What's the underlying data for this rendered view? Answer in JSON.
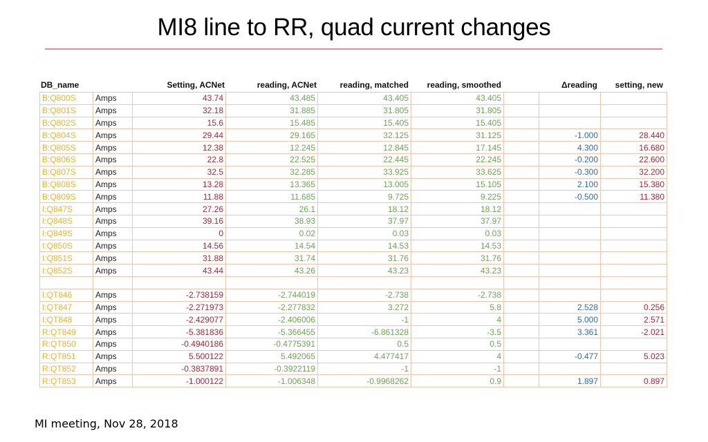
{
  "slide": {
    "title": "MI8 line to RR, quad current changes",
    "footer": "MI meeting, Nov 28, 2018"
  },
  "colors": {
    "title_rule": "#f08a8a",
    "grid_border": "#f5c4a8",
    "name": "#f0b428",
    "setting": "#b22433",
    "reading": "#6aa84f",
    "delta": "#2e6bb3",
    "setting_new": "#b22433"
  },
  "table": {
    "headers": {
      "db_name": "DB_name",
      "setting_acnet": "Setting, ACNet",
      "reading_acnet": "reading, ACNet",
      "reading_matched": "reading, matched",
      "reading_smoothed": "reading, smoothed",
      "delta_reading": "Δreading",
      "setting_new": "setting, new"
    },
    "rows": [
      {
        "name": "B:Q800S",
        "unit": "Amps",
        "setting": "43.74",
        "reading": "43.485",
        "matched": "43.405",
        "smoothed": "43.405",
        "delta": "",
        "new": ""
      },
      {
        "name": "B:Q801S",
        "unit": "Amps",
        "setting": "32.18",
        "reading": "31.885",
        "matched": "31.805",
        "smoothed": "31.805",
        "delta": "",
        "new": ""
      },
      {
        "name": "B:Q802S",
        "unit": "Amps",
        "setting": "15.6",
        "reading": "15.485",
        "matched": "15.405",
        "smoothed": "15.405",
        "delta": "",
        "new": ""
      },
      {
        "name": "B:Q804S",
        "unit": "Amps",
        "setting": "29.44",
        "reading": "29.165",
        "matched": "32.125",
        "smoothed": "31.125",
        "delta": "-1.000",
        "new": "28.440"
      },
      {
        "name": "B:Q805S",
        "unit": "Amps",
        "setting": "12.38",
        "reading": "12.245",
        "matched": "12.845",
        "smoothed": "17.145",
        "delta": "4.300",
        "new": "16.680"
      },
      {
        "name": "B:Q806S",
        "unit": "Amps",
        "setting": "22.8",
        "reading": "22.525",
        "matched": "22.445",
        "smoothed": "22.245",
        "delta": "-0.200",
        "new": "22.600"
      },
      {
        "name": "B:Q807S",
        "unit": "Amps",
        "setting": "32.5",
        "reading": "32.285",
        "matched": "33.925",
        "smoothed": "33.625",
        "delta": "-0.300",
        "new": "32.200"
      },
      {
        "name": "B:Q808S",
        "unit": "Amps",
        "setting": "13.28",
        "reading": "13.365",
        "matched": "13.005",
        "smoothed": "15.105",
        "delta": "2.100",
        "new": "15.380"
      },
      {
        "name": "B:Q809S",
        "unit": "Amps",
        "setting": "11.88",
        "reading": "11.685",
        "matched": "9.725",
        "smoothed": "9.225",
        "delta": "-0.500",
        "new": "11.380"
      },
      {
        "name": "I:Q847S",
        "unit": "Amps",
        "setting": "27.26",
        "reading": "26.1",
        "matched": "18.12",
        "smoothed": "18.12",
        "delta": "",
        "new": ""
      },
      {
        "name": "I:Q848S",
        "unit": "Amps",
        "setting": "39.16",
        "reading": "38.93",
        "matched": "37.97",
        "smoothed": "37.97",
        "delta": "",
        "new": ""
      },
      {
        "name": "I:Q849S",
        "unit": "Amps",
        "setting": "0",
        "reading": "0.02",
        "matched": "0.03",
        "smoothed": "0.03",
        "delta": "",
        "new": ""
      },
      {
        "name": "I:Q850S",
        "unit": "Amps",
        "setting": "14.56",
        "reading": "14.54",
        "matched": "14.53",
        "smoothed": "14.53",
        "delta": "",
        "new": ""
      },
      {
        "name": "I:Q851S",
        "unit": "Amps",
        "setting": "31.88",
        "reading": "31.74",
        "matched": "31.76",
        "smoothed": "31.76",
        "delta": "",
        "new": ""
      },
      {
        "name": "I:Q852S",
        "unit": "Amps",
        "setting": "43.44",
        "reading": "43.26",
        "matched": "43.23",
        "smoothed": "43.23",
        "delta": "",
        "new": ""
      },
      {
        "name": "",
        "unit": "",
        "setting": "",
        "reading": "",
        "matched": "",
        "smoothed": "",
        "delta": "",
        "new": ""
      },
      {
        "name": "I:QT846",
        "unit": "Amps",
        "setting": "-2.738159",
        "reading": "-2.744019",
        "matched": "-2.738",
        "smoothed": "-2.738",
        "delta": "",
        "new": ""
      },
      {
        "name": "I:QT847",
        "unit": "Amps",
        "setting": "-2.271973",
        "reading": "-2.277832",
        "matched": "3.272",
        "smoothed": "5.8",
        "delta": "2.528",
        "new": "0.256"
      },
      {
        "name": "I:QT848",
        "unit": "Amps",
        "setting": "-2.429077",
        "reading": "-2.406006",
        "matched": "-1",
        "smoothed": "4",
        "delta": "5.000",
        "new": "2.571"
      },
      {
        "name": "R:QT849",
        "unit": "Amps",
        "setting": "-5.381836",
        "reading": "-5.366455",
        "matched": "-6.861328",
        "smoothed": "-3.5",
        "delta": "3.361",
        "new": "-2.021"
      },
      {
        "name": "R:QT850",
        "unit": "Amps",
        "setting": "-0.4940186",
        "reading": "-0.4775391",
        "matched": "0.5",
        "smoothed": "0.5",
        "delta": "",
        "new": ""
      },
      {
        "name": "R:QT851",
        "unit": "Amps",
        "setting": "5.500122",
        "reading": "5.492065",
        "matched": "4.477417",
        "smoothed": "4",
        "delta": "-0.477",
        "new": "5.023"
      },
      {
        "name": "R:QT852",
        "unit": "Amps",
        "setting": "-0.3837891",
        "reading": "-0.3922119",
        "matched": "-1",
        "smoothed": "-1",
        "delta": "",
        "new": ""
      },
      {
        "name": "R:QT853",
        "unit": "Amps",
        "setting": "-1.000122",
        "reading": "-1.006348",
        "matched": "-0.9968262",
        "smoothed": "0.9",
        "delta": "1.897",
        "new": "0.897"
      }
    ]
  }
}
